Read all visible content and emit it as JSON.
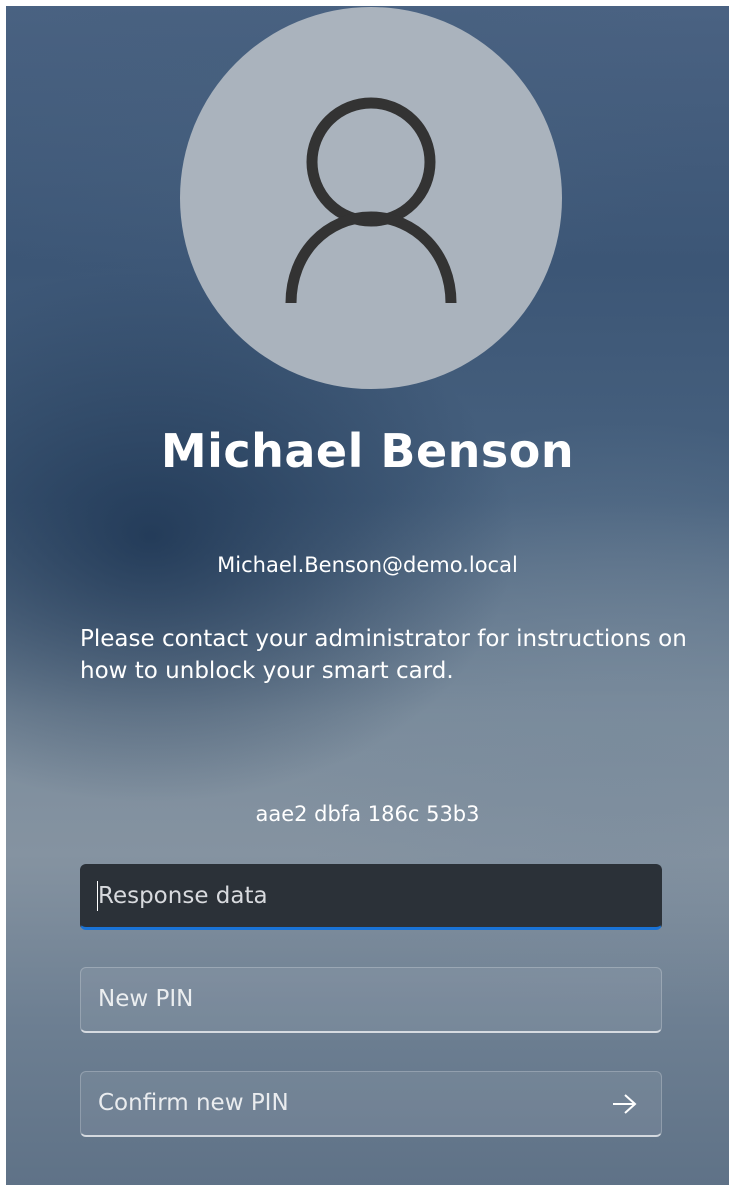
{
  "user": {
    "name": "Michael Benson",
    "email": "Michael.Benson@demo.local"
  },
  "message": "Please contact your administrator for instructions on how to unblock your smart card.",
  "challenge_code": "aae2 dbfa 186c 53b3",
  "fields": {
    "response": {
      "placeholder": "Response data",
      "value": ""
    },
    "new_pin": {
      "placeholder": "New PIN",
      "value": ""
    },
    "confirm_pin": {
      "placeholder": "Confirm new PIN",
      "value": ""
    }
  },
  "icons": {
    "avatar": "user-silhouette-icon",
    "submit": "arrow-right-icon"
  },
  "colors": {
    "focus_accent": "#1a73d6",
    "avatar_bg": "#aab3bd",
    "avatar_icon": "#333333"
  }
}
